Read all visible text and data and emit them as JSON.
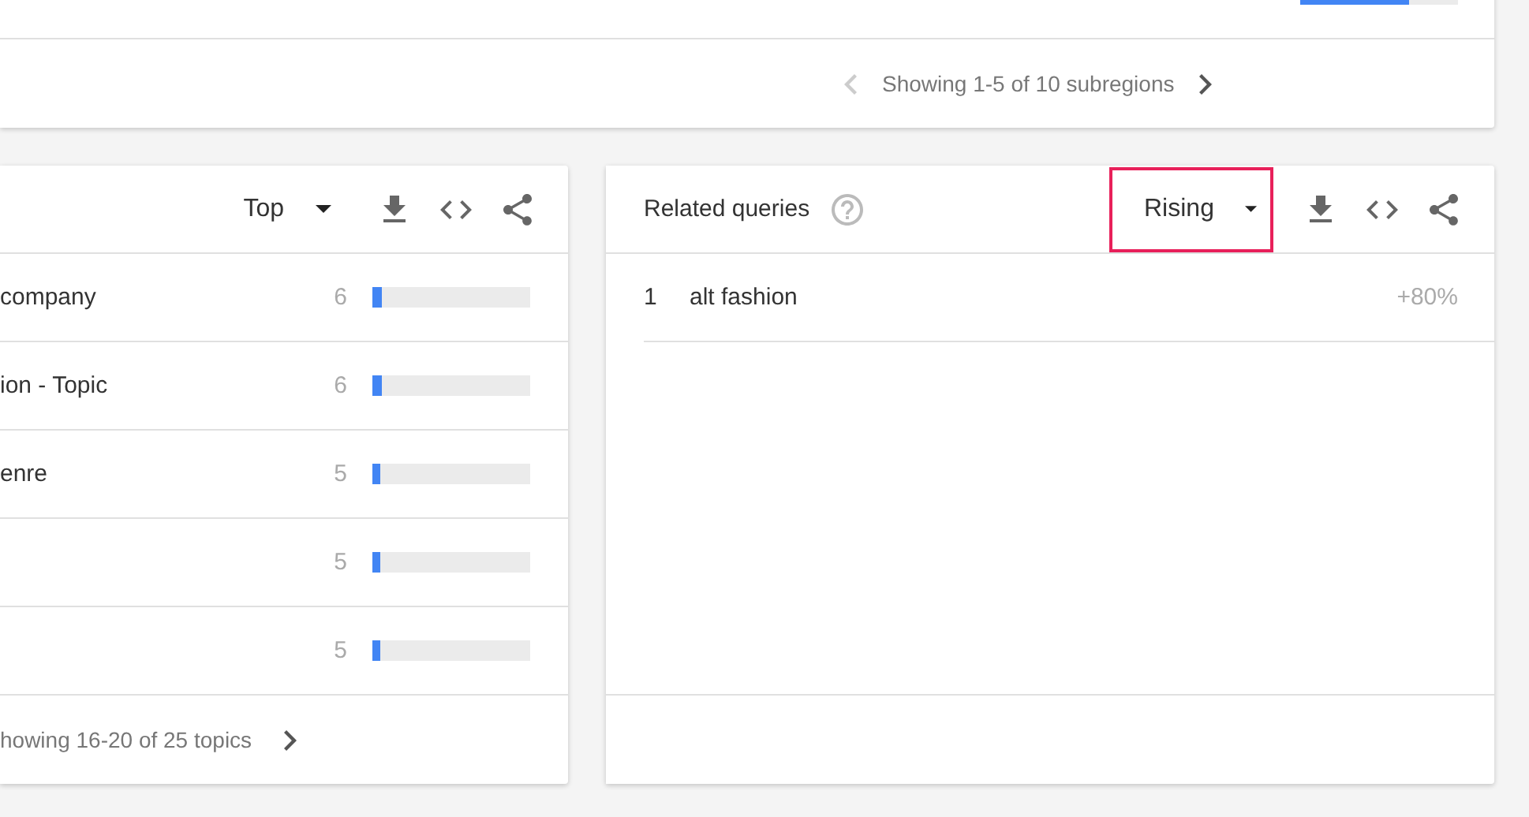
{
  "regions_card": {
    "rows": [
      {
        "level": 0.69
      }
    ],
    "pagination": {
      "text": "Showing 1-5 of 10 subregions",
      "prev_disabled": true,
      "next_disabled": false
    }
  },
  "related_topics": {
    "filter": "Top",
    "filter_highlighted": false,
    "rows": [
      {
        "name": "company",
        "value": "6",
        "level": 0.06
      },
      {
        "name": "ion - Topic",
        "value": "6",
        "level": 0.06
      },
      {
        "name": "enre",
        "value": "5",
        "level": 0.05
      },
      {
        "value": "5",
        "level": 0.05
      },
      {
        "value": "5",
        "level": 0.05
      }
    ],
    "pagination": {
      "text": "howing 16-20 of 25 topics",
      "next_disabled": false
    }
  },
  "related_queries": {
    "title": "Related queries",
    "filter": "Rising",
    "filter_highlighted": true,
    "rows": [
      {
        "rank": "1",
        "query": "alt fashion",
        "value": "+80%"
      }
    ]
  }
}
